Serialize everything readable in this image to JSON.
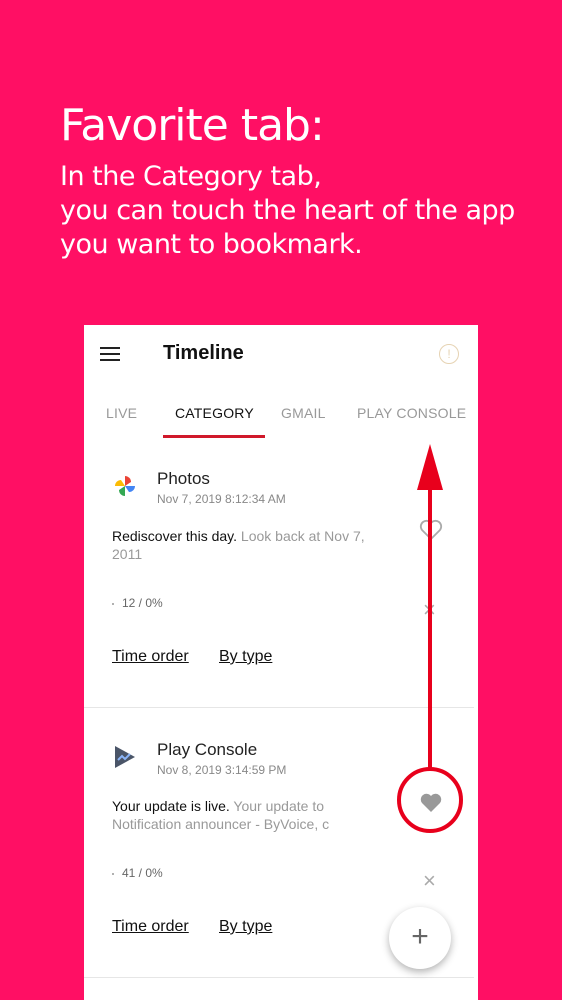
{
  "headline": {
    "title": "Favorite tab:",
    "lines": [
      "In the Category tab,",
      "you can touch the heart of the app",
      "you want to bookmark."
    ]
  },
  "app": {
    "title": "Timeline",
    "tabs": [
      {
        "label": "LIVE",
        "active": false
      },
      {
        "label": "CATEGORY",
        "active": true
      },
      {
        "label": "GMAIL",
        "active": false
      },
      {
        "label": "PLAY CONSOLE",
        "active": false
      }
    ],
    "cards": [
      {
        "app_name": "Photos",
        "icon": "google-photos-icon",
        "time": "Nov 7, 2019 8:12:34 AM",
        "message_main": "Rediscover this day.",
        "message_sub": " Look back at Nov 7, 2011",
        "stats": "12 / 0%",
        "link_time_order": "Time order",
        "link_by_type": "By type"
      },
      {
        "app_name": "Play Console",
        "icon": "play-console-icon",
        "time": "Nov 8, 2019 3:14:59 PM",
        "message_main": "Your update is live.",
        "message_sub": " Your update to Notification announcer - ByVoice, c",
        "stats": "41 / 0%",
        "link_time_order": "Time order",
        "link_by_type": "By type"
      }
    ],
    "fab_label": "+"
  },
  "colors": {
    "background": "#FF0F64",
    "tab_indicator": "#d0182a",
    "annotation": "#e8001c"
  }
}
